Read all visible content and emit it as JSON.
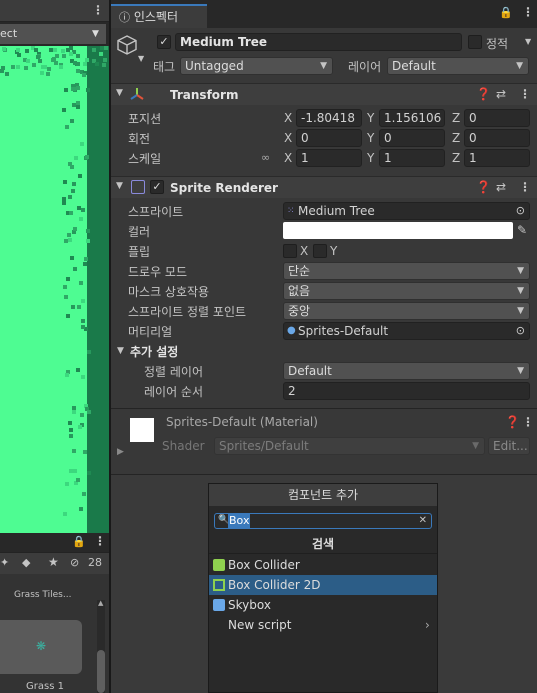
{
  "left_panel": {
    "select_value": "ect",
    "bottom_count": "28",
    "asset_top_label": "Grass Tiles...",
    "asset_label": "Grass 1"
  },
  "inspector": {
    "tab_label": "인스펙터",
    "object": {
      "name": "Medium Tree",
      "static_label": "정적",
      "tag_label": "태그",
      "tag_value": "Untagged",
      "layer_label": "레이어",
      "layer_value": "Default"
    },
    "transform": {
      "title": "Transform",
      "position_label": "포지션",
      "rotation_label": "회전",
      "scale_label": "스케일",
      "x_label": "X",
      "y_label": "Y",
      "z_label": "Z",
      "position": {
        "x": "-1.80418",
        "y": "1.156106",
        "z": "0"
      },
      "rotation": {
        "x": "0",
        "y": "0",
        "z": "0"
      },
      "scale": {
        "x": "1",
        "y": "1",
        "z": "1"
      }
    },
    "sprite_renderer": {
      "title": "Sprite Renderer",
      "sprite_label": "스프라이트",
      "sprite_value": "Medium Tree",
      "color_label": "컬러",
      "color_value": "#ffffff",
      "flip_label": "플립",
      "flip_x": "X",
      "flip_y": "Y",
      "draw_mode_label": "드로우 모드",
      "draw_mode_value": "단순",
      "mask_label": "마스크 상호작용",
      "mask_value": "없음",
      "sort_point_label": "스프라이트 정렬 포인트",
      "sort_point_value": "중앙",
      "material_label": "머티리얼",
      "material_value": "Sprites-Default",
      "additional_label": "추가 설정",
      "sorting_layer_label": "정렬 레이어",
      "sorting_layer_value": "Default",
      "order_label": "레이어 순서",
      "order_value": "2"
    },
    "material": {
      "title": "Sprites-Default (Material)",
      "shader_label": "Shader",
      "shader_value": "Sprites/Default",
      "edit_label": "Edit..."
    }
  },
  "add_component": {
    "button_label": "컴포넌트 추가",
    "search_value": "Box",
    "subtitle": "검색",
    "items": [
      {
        "label": "Box Collider"
      },
      {
        "label": "Box Collider 2D"
      },
      {
        "label": "Skybox"
      },
      {
        "label": "New script"
      }
    ]
  },
  "colors": {
    "accent": "#3a79bb",
    "selection": "#2c5d87",
    "scene_green": "#4efc92"
  }
}
